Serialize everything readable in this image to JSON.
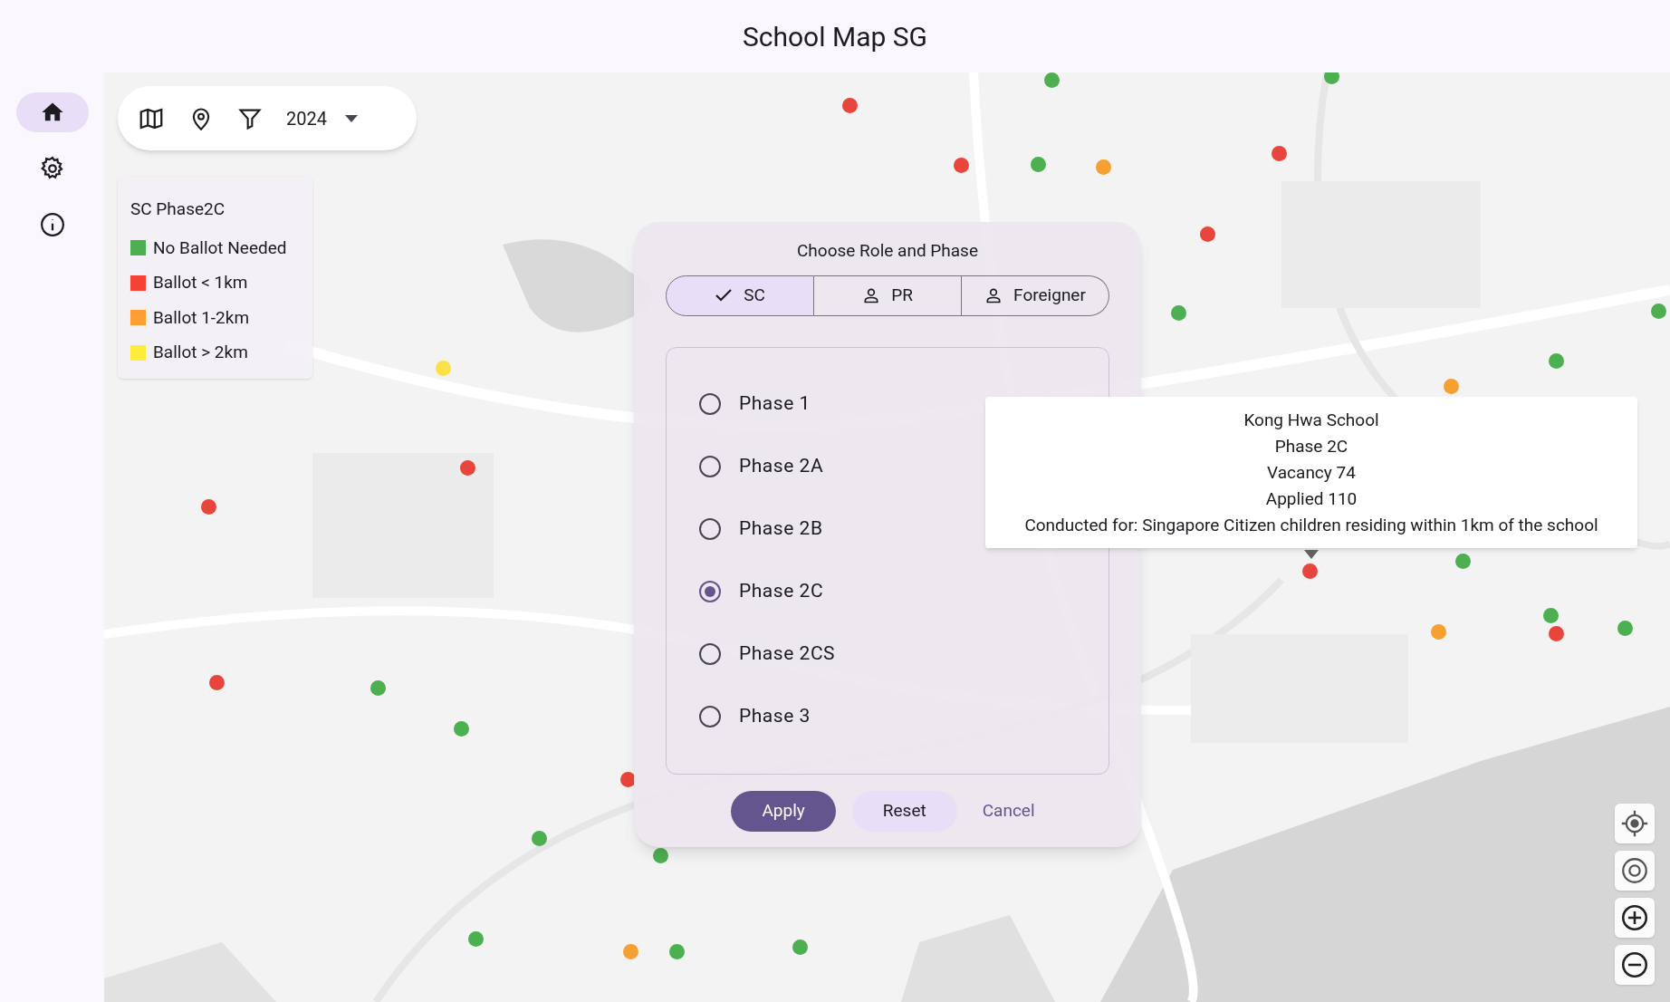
{
  "app_title": "School Map SG",
  "rail": [
    {
      "kind": "home",
      "selected": true
    },
    {
      "kind": "settings",
      "selected": false
    },
    {
      "kind": "info",
      "selected": false
    }
  ],
  "toolbar": {
    "year": "2024"
  },
  "legend": {
    "title": "SC Phase2C",
    "items": [
      {
        "label": "No Ballot Needed",
        "color": "#4caf50"
      },
      {
        "label": "Ballot < 1km",
        "color": "#f44336"
      },
      {
        "label": "Ballot 1-2km",
        "color": "#ff9f33"
      },
      {
        "label": "Ballot > 2km",
        "color": "#ffeb3b"
      }
    ]
  },
  "markers": [
    {
      "color": "#4caf50"
    },
    {
      "color": "#4caf50"
    },
    {
      "color": "#4caf50"
    },
    {
      "color": "#4caf50"
    },
    {
      "color": "#4caf50"
    },
    {
      "color": "#4caf50"
    },
    {
      "color": "#4caf50"
    },
    {
      "color": "#4caf50"
    },
    {
      "color": "#4caf50"
    },
    {
      "color": "#4caf50"
    },
    {
      "color": "#4caf50"
    },
    {
      "color": "#4caf50"
    },
    {
      "color": "#4caf50"
    },
    {
      "color": "#4caf50"
    },
    {
      "color": "#4caf50"
    },
    {
      "color": "#4caf50"
    },
    {
      "color": "#e8453c"
    },
    {
      "color": "#e8453c"
    },
    {
      "color": "#e8453c"
    },
    {
      "color": "#e8453c"
    },
    {
      "color": "#e8453c"
    },
    {
      "color": "#e8453c"
    },
    {
      "color": "#e8453c"
    },
    {
      "color": "#e8453c"
    },
    {
      "color": "#e8453c"
    },
    {
      "color": "#e8453c"
    },
    {
      "color": "#f5a030"
    },
    {
      "color": "#f5a030"
    },
    {
      "color": "#f5a030"
    },
    {
      "color": "#f5a030"
    },
    {
      "color": "#fbe04a"
    }
  ],
  "dialog": {
    "title": "Choose Role and Phase",
    "roles": [
      {
        "label": "SC",
        "selected": true
      },
      {
        "label": "PR",
        "selected": false
      },
      {
        "label": "Foreigner",
        "selected": false
      }
    ],
    "phases": [
      {
        "label": "Phase 1",
        "selected": false
      },
      {
        "label": "Phase 2A",
        "selected": false
      },
      {
        "label": "Phase 2B",
        "selected": false
      },
      {
        "label": "Phase 2C",
        "selected": true
      },
      {
        "label": "Phase 2CS",
        "selected": false
      },
      {
        "label": "Phase 3",
        "selected": false
      }
    ],
    "buttons": [
      {
        "label": "Apply",
        "kind": "filled"
      },
      {
        "label": "Reset",
        "kind": "tonal"
      },
      {
        "label": "Cancel",
        "kind": "text"
      }
    ]
  },
  "tooltip": {
    "lines": [
      "Kong Hwa School",
      "Phase 2C",
      "Vacancy 74",
      "Applied 110",
      "Conducted for: Singapore Citizen children residing within 1km of the school"
    ]
  },
  "map_controls": [
    {
      "kind": "locate"
    },
    {
      "kind": "target"
    },
    {
      "kind": "zoomin"
    },
    {
      "kind": "zoomout"
    }
  ]
}
